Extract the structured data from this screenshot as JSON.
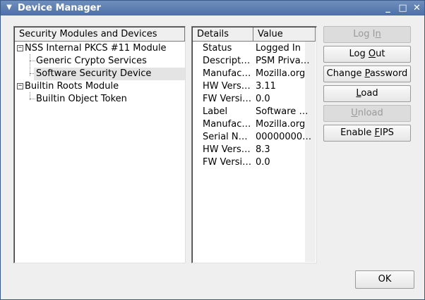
{
  "window": {
    "title": "Device Manager"
  },
  "tree": {
    "header": "Security Modules and Devices",
    "rows": [
      {
        "label": "NSS Internal PKCS #11 Module",
        "expander": "−"
      },
      {
        "label": "Generic Crypto Services"
      },
      {
        "label": "Software Security Device"
      },
      {
        "label": "Builtin Roots Module",
        "expander": "−"
      },
      {
        "label": "Builtin Object Token"
      }
    ]
  },
  "details": {
    "col_details": "Details",
    "col_value": "Value",
    "rows": [
      {
        "key": "Status",
        "value": "Logged In"
      },
      {
        "key": "Descripti…",
        "value": "PSM Privat…"
      },
      {
        "key": "Manufac…",
        "value": "Mozilla.org"
      },
      {
        "key": "HW Versi…",
        "value": "3.11"
      },
      {
        "key": "FW Versi…",
        "value": "0.0"
      },
      {
        "key": "Label",
        "value": "Software S…"
      },
      {
        "key": "Manufac…",
        "value": "Mozilla.org"
      },
      {
        "key": "Serial Nu…",
        "value": "00000000…"
      },
      {
        "key": "HW Versi…",
        "value": "8.3"
      },
      {
        "key": "FW Versi…",
        "value": "0.0"
      }
    ]
  },
  "buttons": {
    "log_in": {
      "pre": "Log I",
      "key": "n",
      "post": ""
    },
    "log_out": {
      "pre": "Log ",
      "key": "O",
      "post": "ut"
    },
    "change_password": {
      "pre": "Change ",
      "key": "P",
      "post": "assword"
    },
    "load": {
      "pre": "",
      "key": "L",
      "post": "oad"
    },
    "unload": {
      "pre": "",
      "key": "U",
      "post": "nload"
    },
    "enable_fips": {
      "pre": "Enable ",
      "key": "F",
      "post": "IPS"
    },
    "ok": "OK"
  }
}
